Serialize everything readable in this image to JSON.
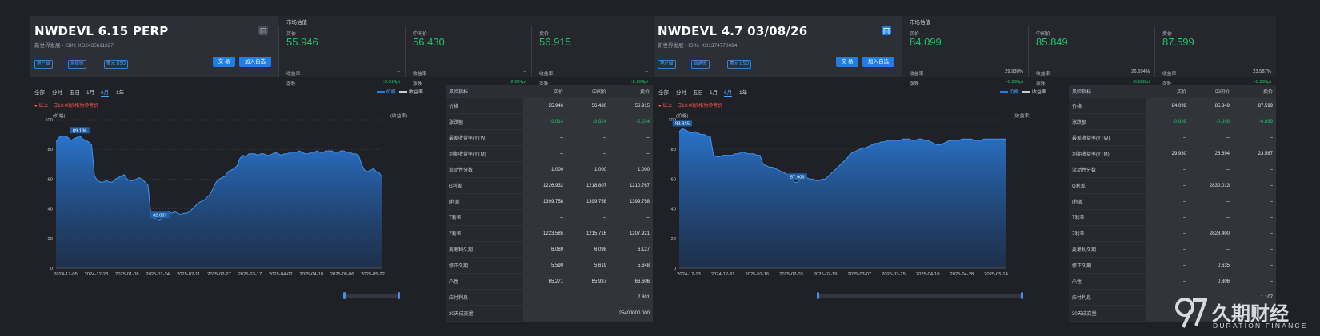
{
  "left": {
    "title": "NWDEVL 6.15 PERP",
    "issuer": "新世界发展 - ISIN:",
    "isin": "XS2435611327",
    "tags": [
      "地产级",
      "永续债",
      "美元 USD"
    ],
    "buttons": {
      "trade": "交 易",
      "watch": "加入自选"
    },
    "market": {
      "title": "市场估值",
      "cols": [
        {
          "label": "买价",
          "price": "55.946",
          "r1_label": "收益率",
          "r1_value": "--",
          "r2_label": "涨跌",
          "r2_value": "-3.014pt"
        },
        {
          "label": "中间价",
          "price": "56.430",
          "r1_label": "收益率",
          "r1_value": "--",
          "r2_label": "涨跌",
          "r2_value": "-2.824pt"
        },
        {
          "label": "卖价",
          "price": "56.915",
          "r1_label": "收益率",
          "r1_value": "--",
          "r2_label": "涨跌",
          "r2_value": "-2.634pt"
        }
      ]
    },
    "periods": [
      "全部",
      "分时",
      "五日",
      "1月",
      "6月",
      "1年"
    ],
    "active_period": "6月",
    "legend": {
      "price": "价格",
      "yield": "收益率"
    },
    "warning": "以上一日16:00价格为参考价",
    "axis_left": "(价格)",
    "axis_right": "(收益率)",
    "chart_data": {
      "type": "area",
      "ylim": [
        0,
        100
      ],
      "yticks": [
        "0",
        "20",
        "40",
        "60",
        "80",
        "100"
      ],
      "xticks": [
        "2024-12-05",
        "2024-12-23",
        "2025-01-08",
        "2025-01-24",
        "2025-02-11",
        "2025-02-27",
        "2025-03-17",
        "2025-04-02",
        "2025-04-18",
        "2025-05-06",
        "2025-05-22"
      ],
      "annotations": [
        {
          "label": "89.136"
        },
        {
          "label": "32.087"
        }
      ],
      "values": [
        85,
        88,
        89,
        89,
        88,
        86,
        87,
        88,
        89.1,
        87,
        86,
        85,
        83,
        62,
        59,
        58,
        58,
        59,
        58,
        58,
        60,
        61,
        62,
        63,
        60,
        59,
        59,
        60,
        61,
        60,
        58,
        56,
        36,
        34,
        33,
        32.1,
        35,
        37,
        38,
        37,
        38,
        37,
        36,
        37,
        37,
        38,
        40,
        42,
        44,
        45,
        46,
        48,
        50,
        54,
        58,
        60,
        61,
        62,
        65,
        66,
        67,
        69,
        74,
        76,
        75,
        77,
        77,
        77,
        76,
        77,
        77,
        76,
        76,
        77,
        78,
        77,
        76,
        77,
        77,
        78,
        78,
        78,
        79,
        78,
        77,
        77,
        78,
        78,
        79,
        78,
        78,
        79,
        79,
        79,
        78,
        78,
        79,
        79,
        78,
        78,
        77,
        77,
        76,
        70,
        66,
        65,
        66,
        67,
        65,
        64,
        61
      ]
    },
    "risk_table": {
      "headers": [
        "风险指标",
        "买价",
        "中间价",
        "卖价"
      ],
      "rows": [
        [
          "价格",
          "55.946",
          "56.430",
          "56.915"
        ],
        [
          "涨跌额",
          "-3.014",
          "-2.824",
          "-2.634"
        ],
        [
          "最差收益率(YTW)",
          "--",
          "--",
          "--"
        ],
        [
          "到期收益率(YTM)",
          "--",
          "--",
          "--"
        ],
        [
          "流动性分数",
          "1.000",
          "1.000",
          "1.000"
        ],
        [
          "G利差",
          "1226.932",
          "1218.807",
          "1210.767"
        ],
        [
          "I利差",
          "1399.758",
          "1399.758",
          "1399.758"
        ],
        [
          "T利差",
          "--",
          "--",
          "--"
        ],
        [
          "Z利差",
          "1223.585",
          "1215.716",
          "1207.921"
        ],
        [
          "麦考利久期",
          "6.069",
          "6.098",
          "6.127"
        ],
        [
          "修正久期",
          "5.590",
          "5.619",
          "5.648"
        ],
        [
          "凸性",
          "65.271",
          "65.937",
          "66.606"
        ],
        [
          "应付利息",
          "",
          "",
          "2.801"
        ],
        [
          "30天成交量",
          "",
          "",
          "25400000.000"
        ]
      ]
    }
  },
  "right": {
    "title": "NWDEVL 4.7 03/08/26",
    "issuer": "新世界发展 - ISIN:",
    "isin": "XS1374770094",
    "tags": [
      "地产级",
      "普通债",
      "美元 USD"
    ],
    "buttons": {
      "trade": "交 易",
      "watch": "加入自选"
    },
    "market": {
      "title": "市场估值",
      "cols": [
        {
          "label": "买价",
          "price": "84.099",
          "r1_label": "收益率",
          "r1_value": "29.930%",
          "r2_label": "涨跌",
          "r2_value": "-0.899pt"
        },
        {
          "label": "中间价",
          "price": "85.849",
          "r1_label": "收益率",
          "r1_value": "26.694%",
          "r2_label": "涨跌",
          "r2_value": "-0.898pt"
        },
        {
          "label": "卖价",
          "price": "87.599",
          "r1_label": "收益率",
          "r1_value": "23.587%",
          "r2_label": "涨跌",
          "r2_value": "-0.899pt"
        }
      ]
    },
    "periods": [
      "全部",
      "分时",
      "五日",
      "1月",
      "6月",
      "1年"
    ],
    "active_period": "6月",
    "legend": {
      "price": "价格",
      "yield": "收益率"
    },
    "warning": "以上一日16:00价格为参考价",
    "axis_left": "(价格)",
    "axis_right": "(收益率)",
    "chart_data": {
      "type": "area",
      "ylim": [
        0,
        100
      ],
      "yticks": [
        "0",
        "20",
        "40",
        "60",
        "80",
        "100"
      ],
      "xticks": [
        "2024-12-13",
        "2024-12-31",
        "2025-01-16",
        "2025-02-03",
        "2025-02-19",
        "2025-03-07",
        "2025-03-25",
        "2025-04-10",
        "2025-04-28",
        "2025-05-14"
      ],
      "annotations": [
        {
          "label": "93.915"
        },
        {
          "label": "57.906"
        }
      ],
      "values": [
        92,
        93.9,
        93,
        92,
        91,
        92,
        91,
        90,
        90,
        89,
        89,
        76,
        75,
        75,
        76,
        76,
        76,
        76,
        77,
        77,
        78,
        78,
        77,
        77,
        77,
        76,
        76,
        70,
        69,
        68,
        68,
        67,
        66,
        65,
        64,
        63,
        62,
        58,
        57.9,
        60,
        61,
        61,
        60,
        60,
        59,
        59,
        60,
        60,
        62,
        64,
        66,
        68,
        70,
        72,
        74,
        77,
        78,
        79,
        80,
        81,
        81,
        82,
        83,
        84,
        84,
        85,
        85,
        86,
        86,
        86,
        86,
        86,
        87,
        87,
        87,
        86,
        86,
        87,
        87,
        86,
        86,
        85,
        84,
        83,
        83,
        84,
        85,
        86,
        86,
        86,
        86,
        87,
        87,
        87,
        87,
        86,
        86,
        86,
        87,
        87,
        87,
        87,
        87,
        87,
        87,
        87
      ]
    },
    "risk_table": {
      "headers": [
        "风险指标",
        "买价",
        "中间价",
        "卖价"
      ],
      "rows": [
        [
          "价格",
          "84.099",
          "85.849",
          "87.599"
        ],
        [
          "涨跌额",
          "-0.899",
          "-0.899",
          "-0.899"
        ],
        [
          "最差收益率(YTW)",
          "--",
          "--",
          "--"
        ],
        [
          "到期收益率(YTM)",
          "29.930",
          "26.694",
          "23.587"
        ],
        [
          "流动性分数",
          "--",
          "--",
          "--"
        ],
        [
          "G利差",
          "--",
          "2830.013",
          "--"
        ],
        [
          "I利差",
          "--",
          "--",
          "--"
        ],
        [
          "T利差",
          "--",
          "--",
          "--"
        ],
        [
          "Z利差",
          "--",
          "2828.400",
          "--"
        ],
        [
          "麦考利久期",
          "--",
          "--",
          "--"
        ],
        [
          "修正久期",
          "--",
          "0.635",
          "--"
        ],
        [
          "凸性",
          "--",
          "0.806",
          "--"
        ],
        [
          "应付利息",
          "",
          "",
          "1.107"
        ],
        [
          "30天成交量",
          "",
          "",
          ""
        ]
      ]
    }
  },
  "watermark": {
    "brand": "久期财经",
    "en": "DURATION FINANCE"
  },
  "colors": {
    "accent": "#1f7ee8",
    "up": "#22c36b",
    "warn": "#ff5a5a"
  }
}
